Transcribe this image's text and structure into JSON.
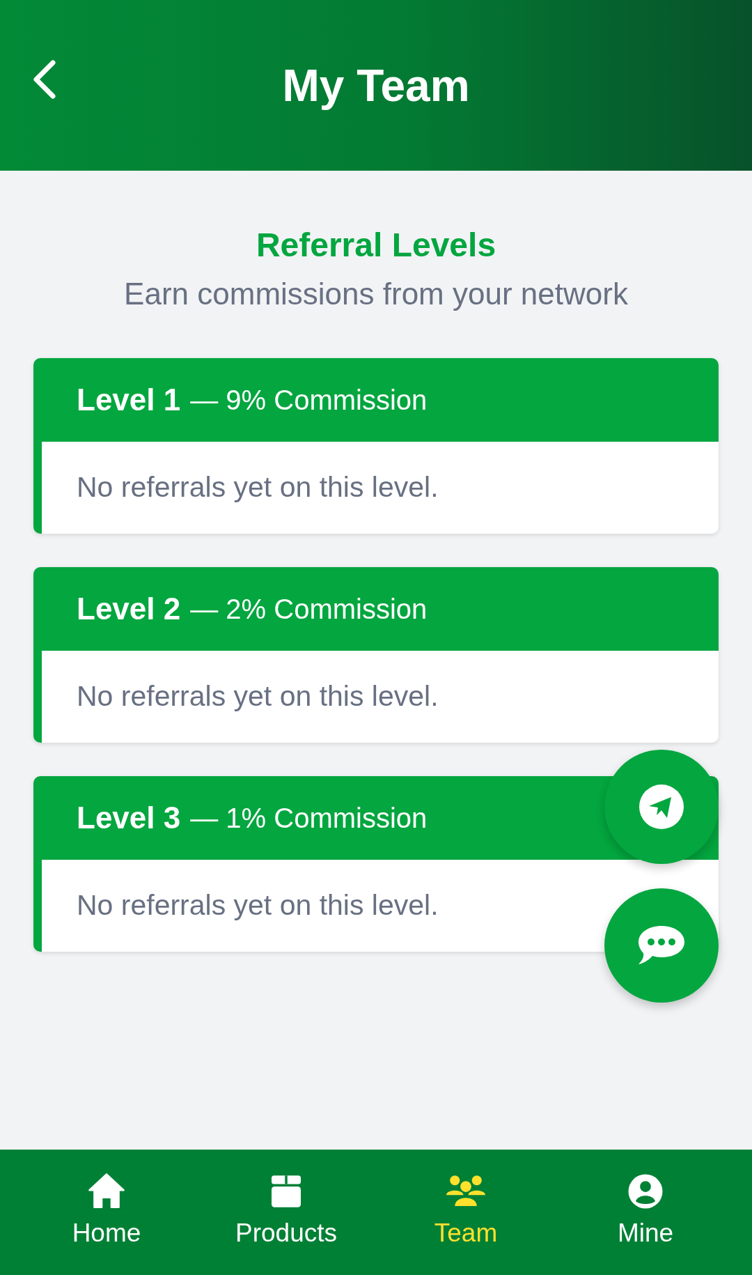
{
  "header": {
    "title": "My Team"
  },
  "intro": {
    "title": "Referral Levels",
    "subtitle": "Earn commissions from your network"
  },
  "levels": [
    {
      "level": "Level 1",
      "commission": "— 9% Commission",
      "message": "No referrals yet on this level."
    },
    {
      "level": "Level 2",
      "commission": "— 2% Commission",
      "message": "No referrals yet on this level."
    },
    {
      "level": "Level 3",
      "commission": "— 1% Commission",
      "message": "No referrals yet on this level."
    }
  ],
  "floating_buttons": [
    {
      "kind": "telegram"
    },
    {
      "kind": "chat"
    }
  ],
  "nav": [
    {
      "label": "Home",
      "kind": "home",
      "selected": false
    },
    {
      "label": "Products",
      "kind": "box",
      "selected": false
    },
    {
      "label": "Team",
      "kind": "team",
      "selected": true
    },
    {
      "label": "Mine",
      "kind": "user",
      "selected": false
    }
  ]
}
